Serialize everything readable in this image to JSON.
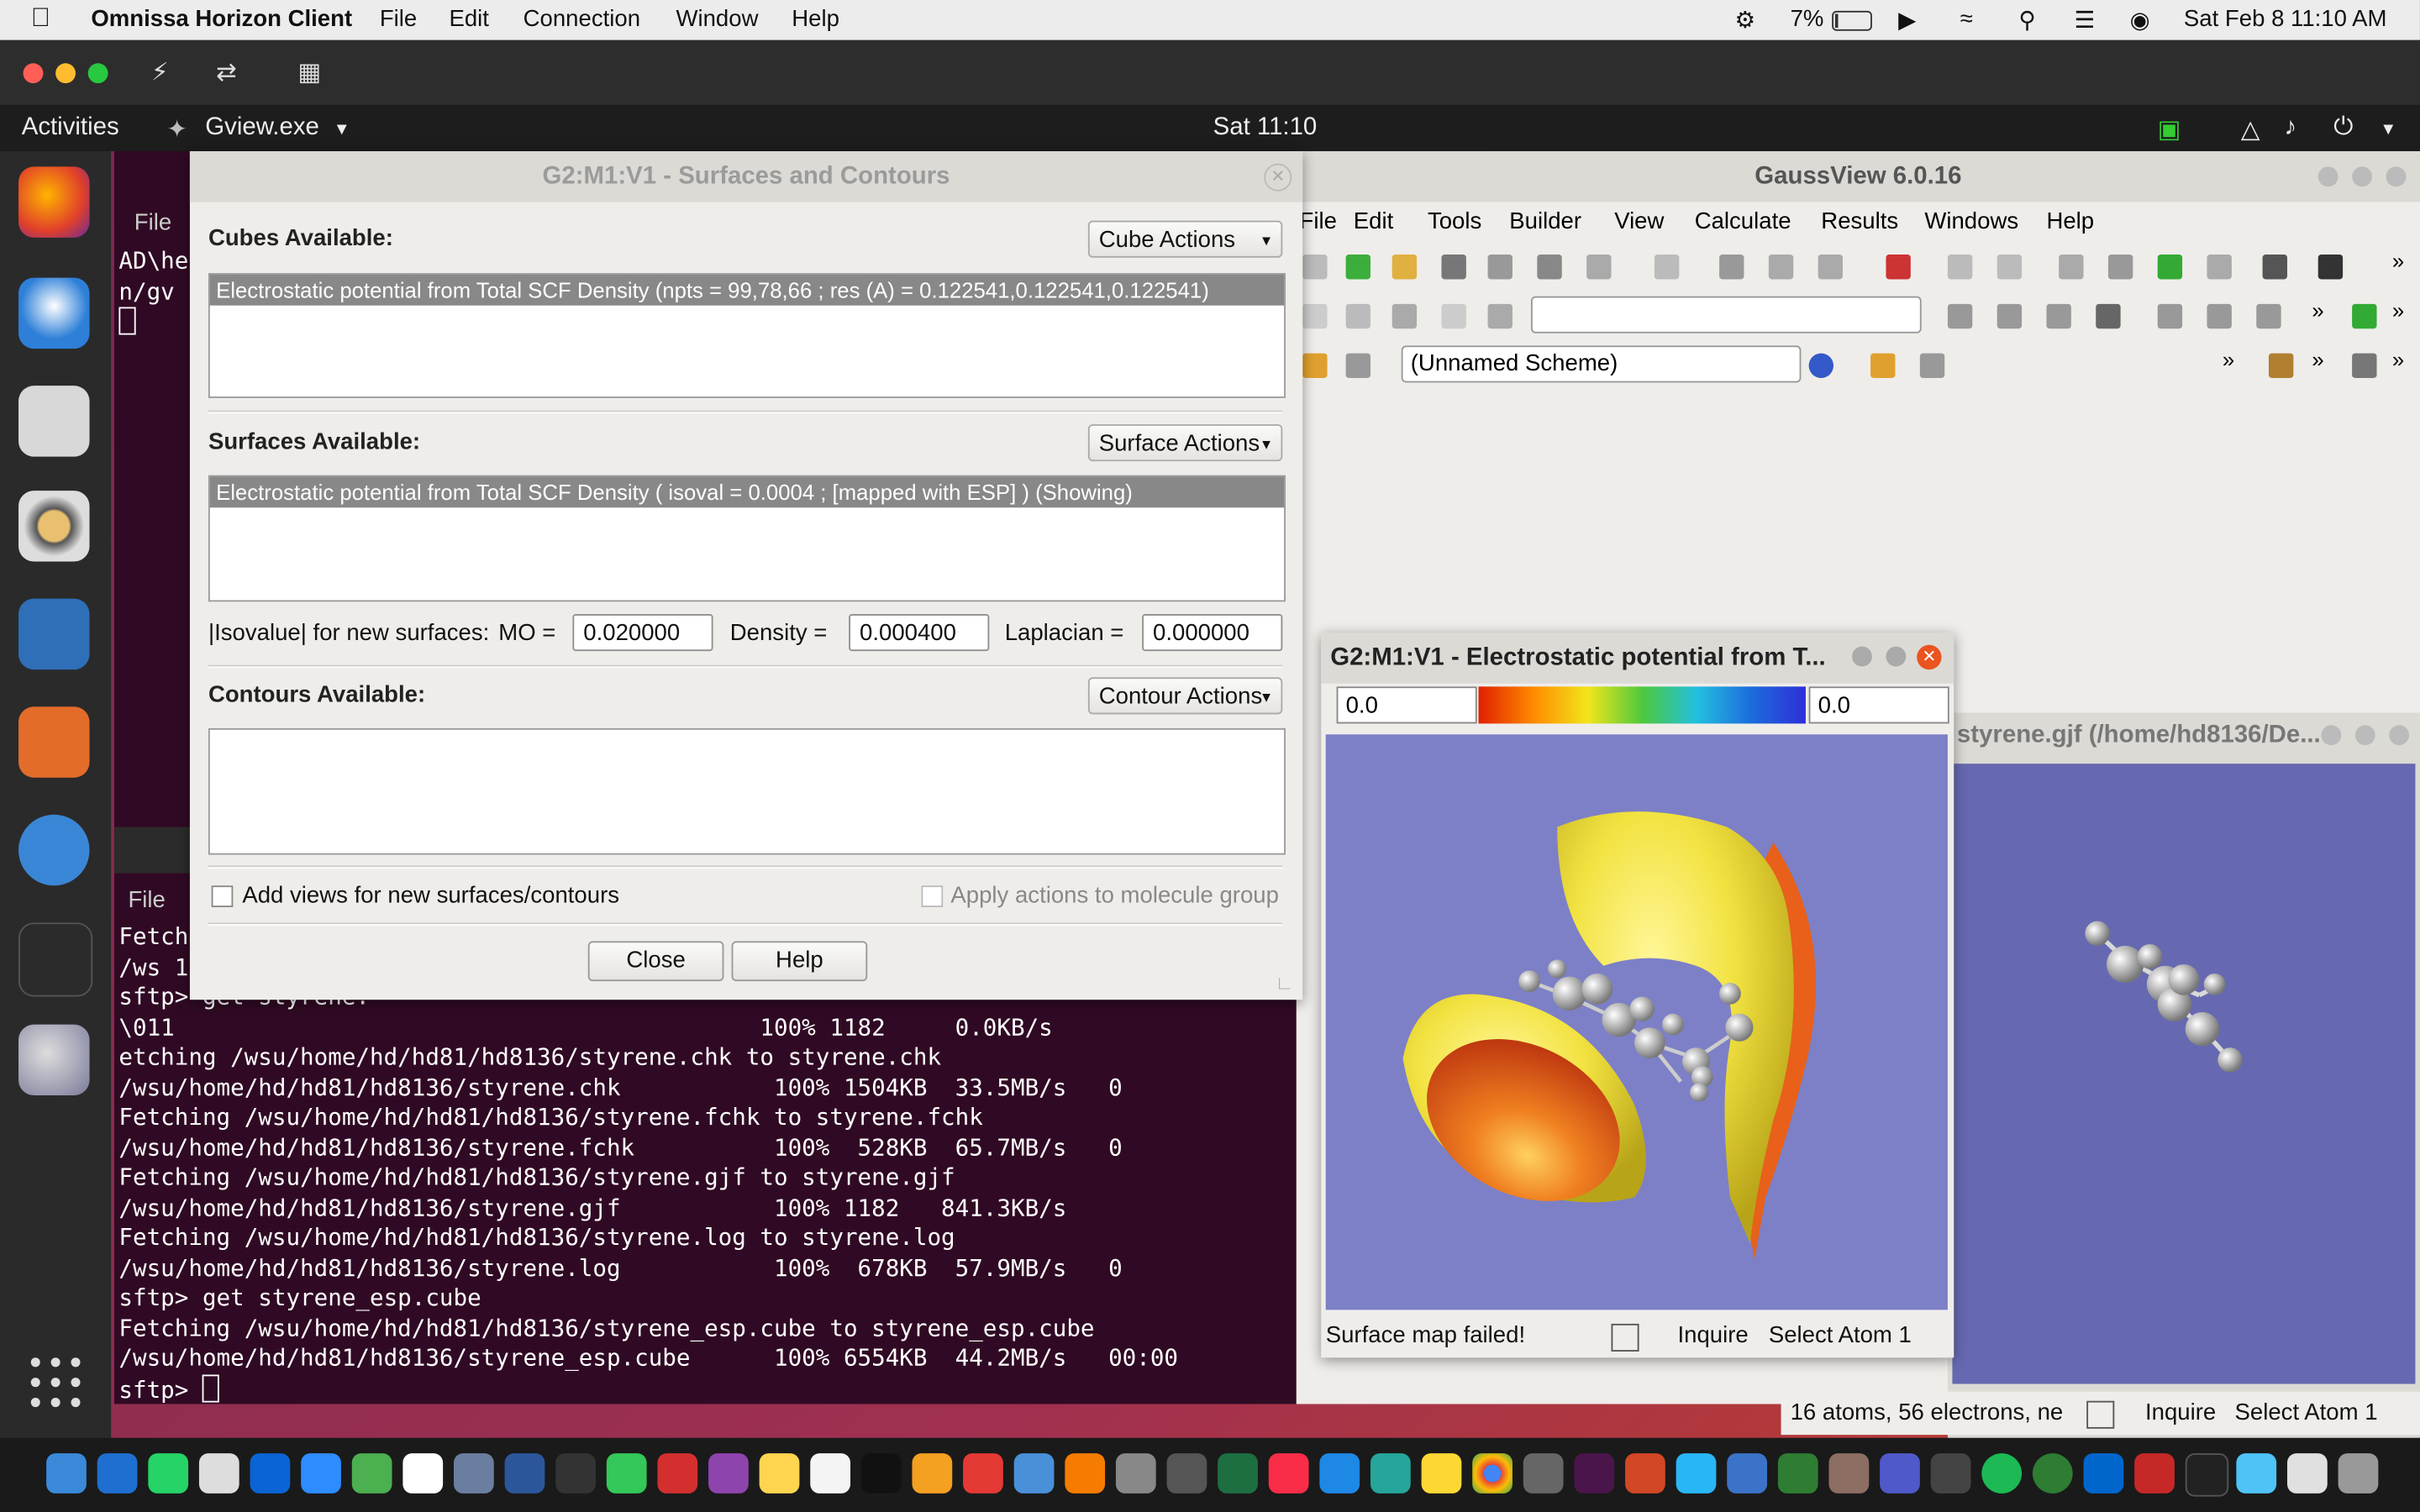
{
  "mac_menubar": {
    "app_name": "Omnissa Horizon Client",
    "menus": [
      "File",
      "Edit",
      "Connection",
      "Window",
      "Help"
    ],
    "battery": "7%",
    "datetime": "Sat Feb 8  11:10 AM"
  },
  "ubuntu_topbar": {
    "activities": "Activities",
    "app_menu": "Gview.exe",
    "clock": "Sat 11:10"
  },
  "terminal": {
    "file_menu_top": "File",
    "file_menu_bottom": "File",
    "top_fragments": [
      "AD\\he",
      "n/gv"
    ],
    "lines": [
      "Fetch",
      "/ws 1",
      "sftp> get styrene.*",
      "\\011                                          100% 1182     0.0KB/s   ",
      "etching /wsu/home/hd/hd81/hd8136/styrene.chk to styrene.chk",
      "/wsu/home/hd/hd81/hd8136/styrene.chk           100% 1504KB  33.5MB/s   0",
      "Fetching /wsu/home/hd/hd81/hd8136/styrene.fchk to styrene.fchk",
      "/wsu/home/hd/hd81/hd8136/styrene.fchk          100%  528KB  65.7MB/s   0",
      "Fetching /wsu/home/hd/hd81/hd8136/styrene.gjf to styrene.gjf",
      "/wsu/home/hd/hd81/hd8136/styrene.gjf           100% 1182   841.3KB/s   ",
      "Fetching /wsu/home/hd/hd81/hd8136/styrene.log to styrene.log",
      "/wsu/home/hd/hd81/hd8136/styrene.log           100%  678KB  57.9MB/s   0",
      "sftp> get styrene_esp.cube",
      "Fetching /wsu/home/hd/hd81/hd8136/styrene_esp.cube to styrene_esp.cube",
      "/wsu/home/hd/hd81/hd8136/styrene_esp.cube      100% 6554KB  44.2MB/s   00:00",
      "sftp> "
    ]
  },
  "gaussview": {
    "title": "GaussView 6.0.16",
    "menus": [
      "File",
      "Edit",
      "Tools",
      "Builder",
      "View",
      "Calculate",
      "Results",
      "Windows",
      "Help"
    ],
    "scheme": "(Unnamed Scheme)"
  },
  "styrene_view": {
    "title": "styrene.gjf (/home/hd8136/De...",
    "status": "16 atoms, 56 electrons, ne",
    "inquire": "Inquire",
    "select": "Select Atom 1"
  },
  "dialog": {
    "title": "G2:M1:V1 - Surfaces and Contours",
    "cubes_label": "Cubes Available:",
    "cube_actions": "Cube Actions",
    "cube_item": "Electrostatic potential from Total SCF Density (npts = 99,78,66 ; res (A) = 0.122541,0.122541,0.122541)",
    "surfaces_label": "Surfaces Available:",
    "surface_actions": "Surface Actions",
    "surface_item": "Electrostatic potential from Total SCF Density ( isoval = 0.0004 ; [mapped with ESP] ) (Showing)",
    "isovalue_label": "|Isovalue| for new surfaces:",
    "mo_label": "MO =",
    "mo_value": "0.020000",
    "density_label": "Density =",
    "density_value": "0.000400",
    "laplacian_label": "Laplacian =",
    "laplacian_value": "0.000000",
    "contours_label": "Contours Available:",
    "contour_actions": "Contour Actions",
    "add_views_label": "Add views for new surfaces/contours",
    "apply_actions_label": "Apply actions to molecule group",
    "close_button": "Close",
    "help_button": "Help"
  },
  "esp_window": {
    "title": "G2:M1:V1 - Electrostatic potential from T...",
    "min_value": "0.0",
    "max_value": "0.0",
    "status": "Surface map failed!",
    "inquire": "Inquire",
    "select": "Select Atom 1"
  },
  "colors": {
    "terminal_bg": "#300a24",
    "esp_bg": "#7d80c6",
    "surface_yellow": "#f2e240",
    "surface_orange": "#e8601a"
  }
}
